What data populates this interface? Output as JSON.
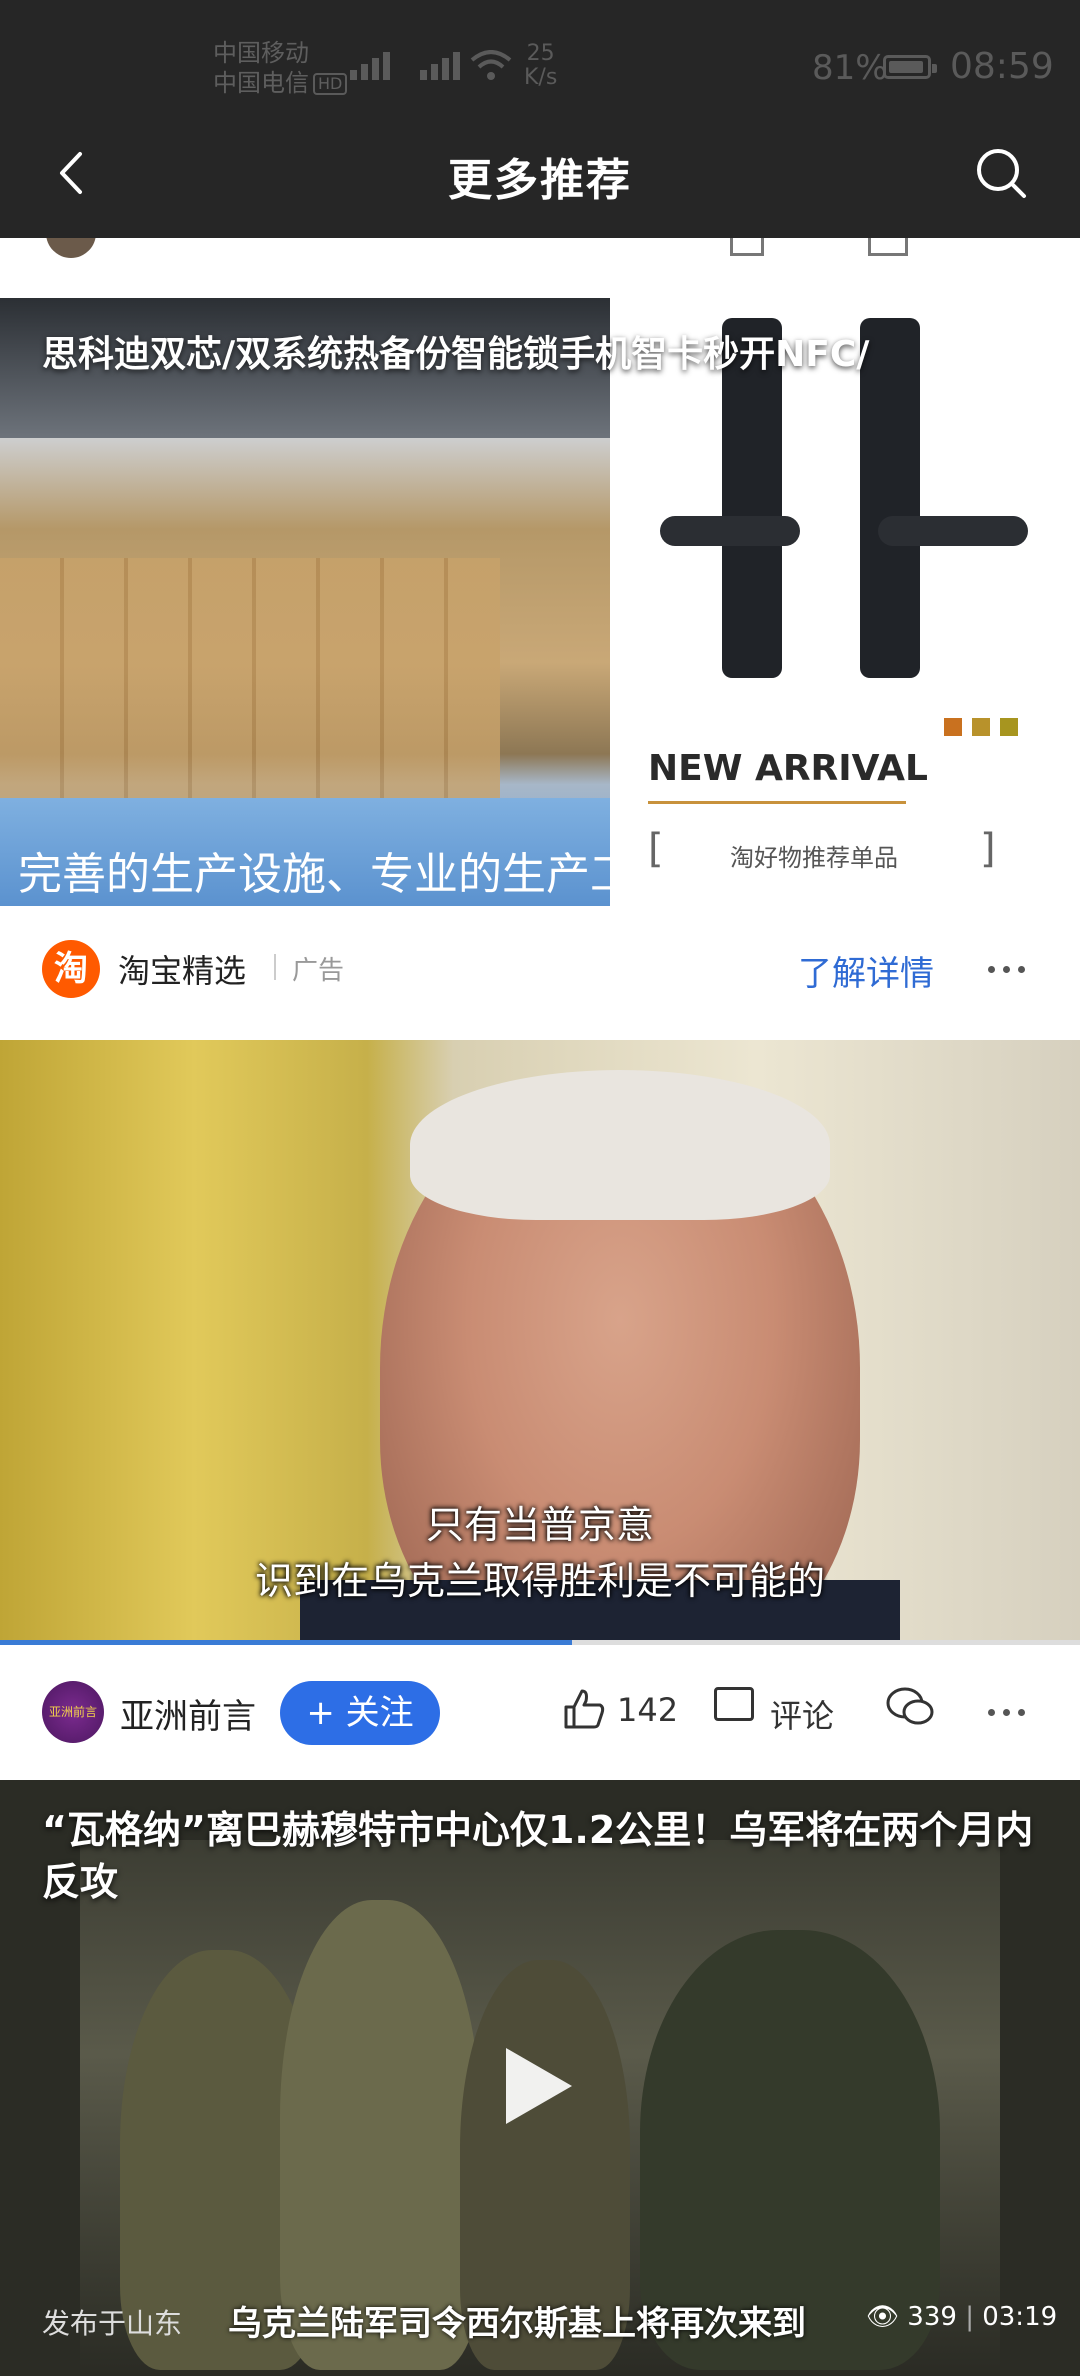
{
  "status_bar": {
    "carrier_1": "中国移动",
    "carrier_2": "中国电信",
    "hd": "HD",
    "net_speed_value": "25",
    "net_speed_unit": "K/s",
    "battery": "81%",
    "time": "08:59"
  },
  "nav": {
    "title": "更多推荐",
    "back_icon": "chevron-left-icon",
    "search_icon": "search-icon"
  },
  "ad_card": {
    "title": "思科迪双芯/双系统热备份智能锁手机智卡秒开NFC/",
    "image_left_caption": "完善的生产设施、专业的生产工人",
    "image_right_heading": "NEW ARRIVAL",
    "image_right_caption": "淘好物推荐单品",
    "bracket_left": "[",
    "bracket_right": "]",
    "source_logo_char": "淘",
    "source_name": "淘宝精选",
    "ad_label": "广告",
    "cta": "了解详情"
  },
  "video_card": {
    "subtitle_line1": "只有当普京意",
    "subtitle_line2": "识到在乌克兰取得胜利是不可能的",
    "progress": 0.53,
    "avatar_text": "亚洲前言",
    "author": "亚洲前言",
    "follow_label": "+ 关注",
    "likes": "142",
    "comment_label": "评论",
    "icons": [
      "thumbs-up-icon",
      "comment-icon",
      "wechat-icon",
      "more-icon"
    ]
  },
  "video_card_2": {
    "title": "“瓦格纳”离巴赫穆特市中心仅1.2公里！乌军将在两个月内反攻",
    "subtitle": "乌克兰陆军司令西尔斯基上将再次来到",
    "location": "发布于山东",
    "views": "339",
    "duration": "03:19"
  },
  "colors": {
    "accent": "#2d6ee6",
    "taobao": "#ff5a00",
    "topbar": "#262626"
  }
}
